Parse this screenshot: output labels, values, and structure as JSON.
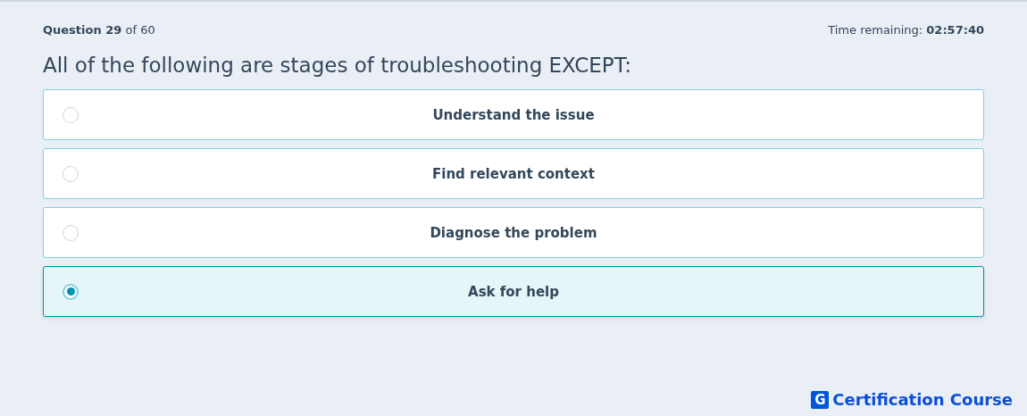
{
  "header": {
    "progress": "**Question 29** of 60",
    "timer": "Time remaining: **02:57:40**"
  },
  "question": "All of the following are stages of troubleshooting EXCEPT:",
  "options": [
    {
      "label": "Understand the issue",
      "selected": false
    },
    {
      "label": "Find relevant context",
      "selected": false
    },
    {
      "label": "Diagnose the problem",
      "selected": false
    },
    {
      "label": "Ask for help",
      "selected": true
    }
  ],
  "logo": {
    "mark": "G",
    "text": "Certification Course"
  }
}
